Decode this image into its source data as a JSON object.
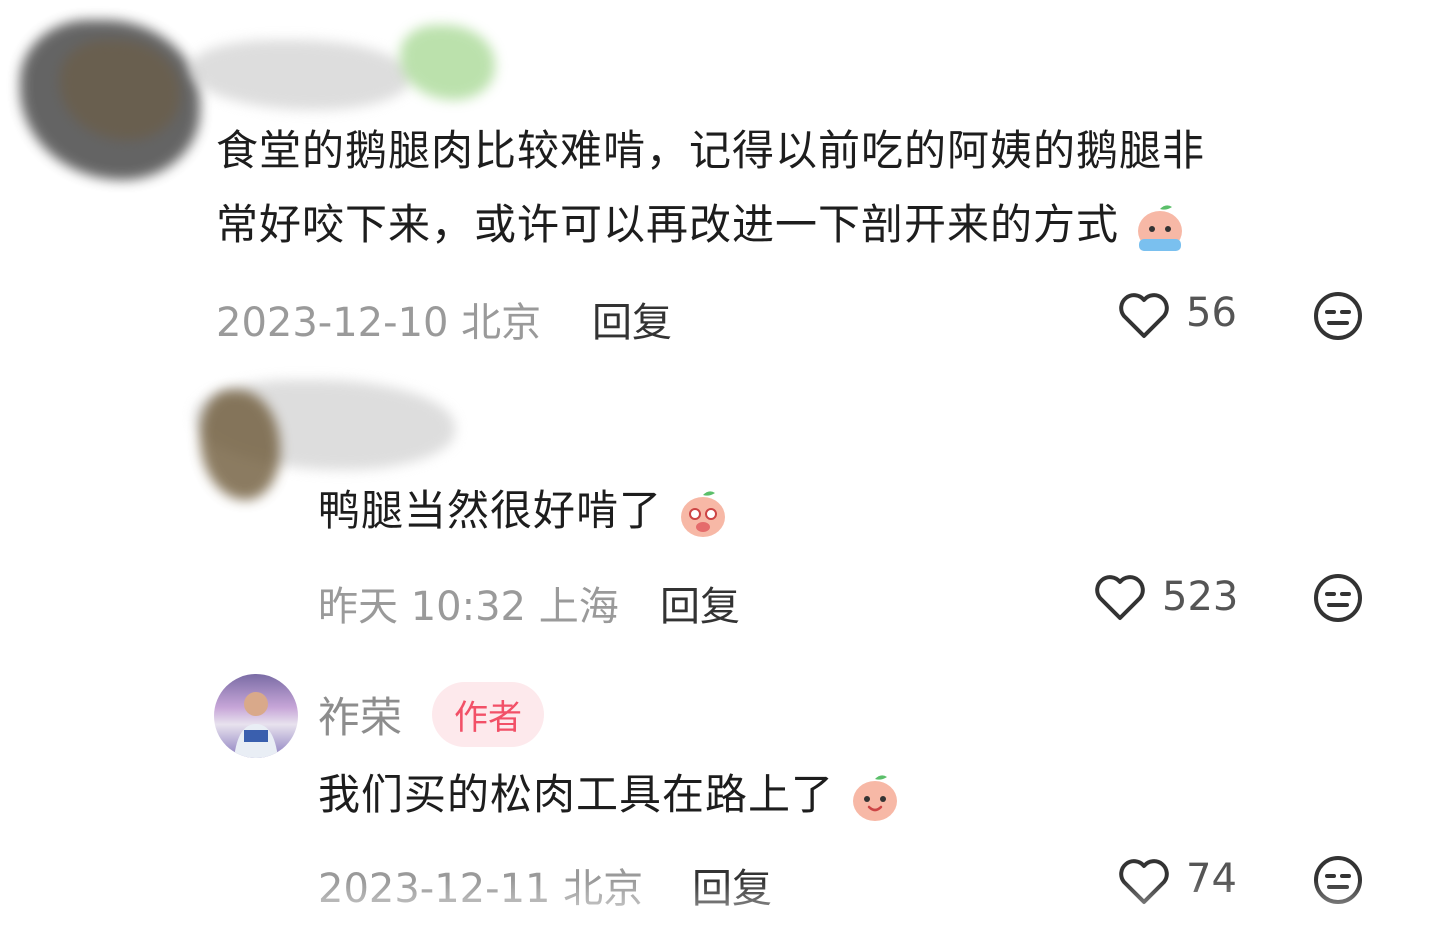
{
  "comments": [
    {
      "text_line1": "食堂的鹅腿肉比较难啃，记得以前吃的阿姨的鹅腿非",
      "text_line2": "常好咬下来，或许可以再改进一下剖开来的方式",
      "emoji": "crying-peach-emoji",
      "meta": "2023-12-10 北京",
      "reply_label": "回复",
      "likes": "56"
    },
    {
      "text": "鸭腿当然很好啃了",
      "emoji": "giggling-peach-emoji",
      "meta": "昨天 10:32 上海",
      "reply_label": "回复",
      "likes": "523"
    },
    {
      "author": "祚荣",
      "badge": "作者",
      "text": "我们买的松肉工具在路上了",
      "emoji": "smiling-peach-emoji",
      "meta": "2023-12-11 北京",
      "reply_label": "回复",
      "likes": "74"
    }
  ],
  "colors": {
    "text": "#1d1d1d",
    "meta": "#9a9a9a",
    "badge_bg": "#fde9ec",
    "badge_text": "#f25067"
  }
}
